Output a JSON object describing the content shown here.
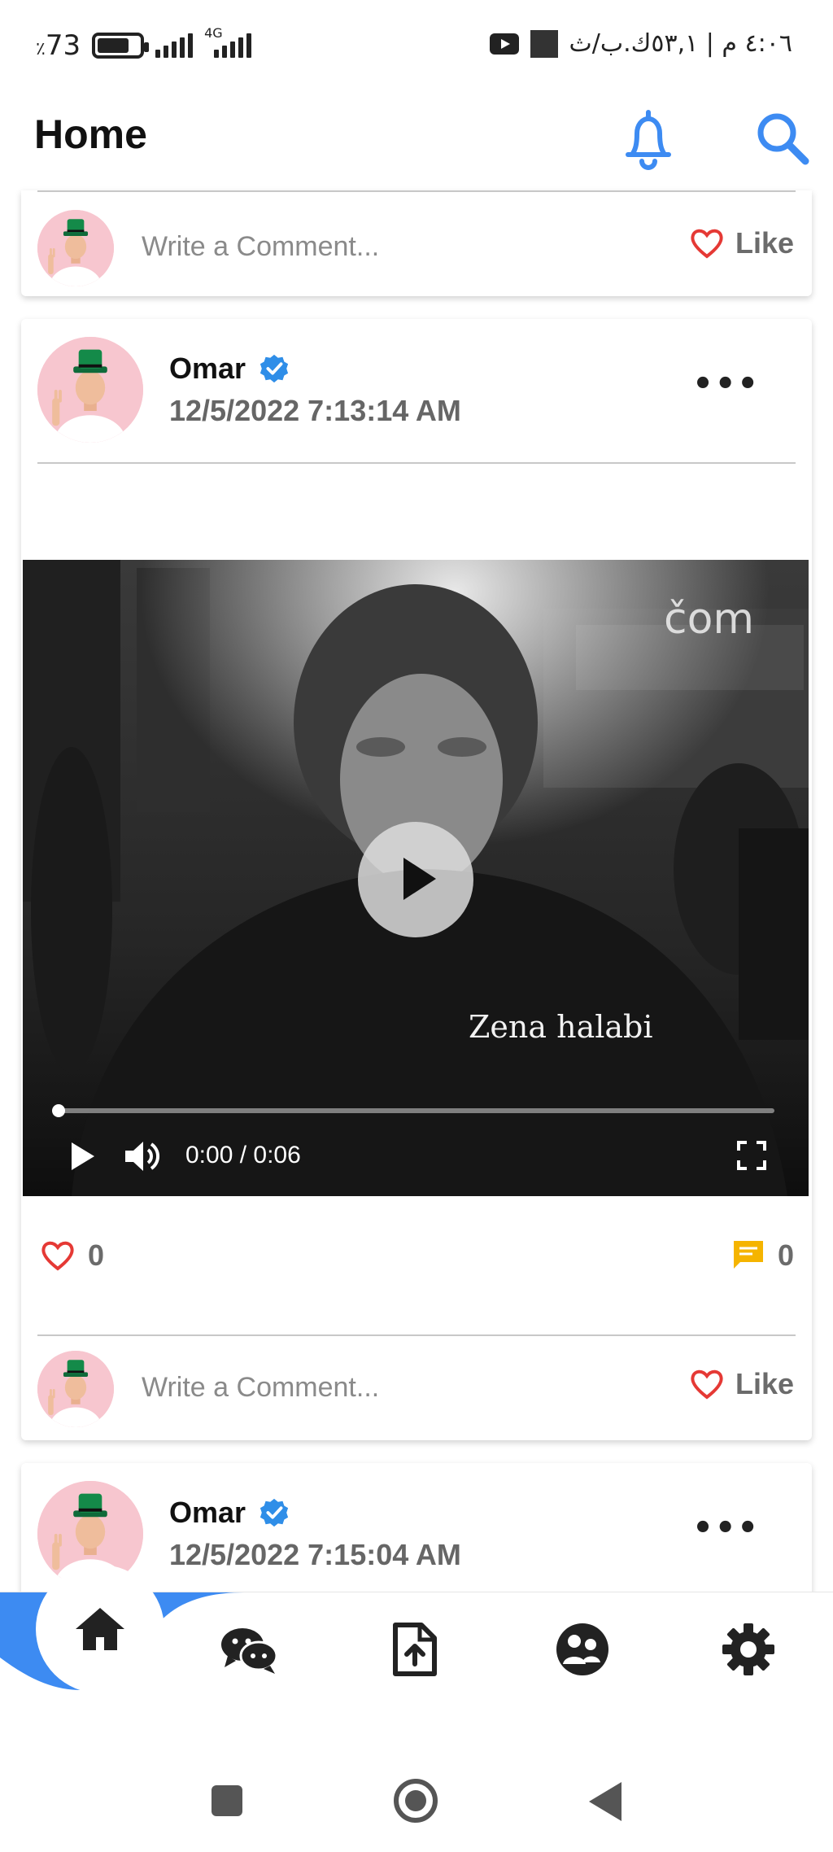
{
  "status_bar": {
    "battery_text": "73",
    "battery_level": 0.73,
    "network": "4G",
    "clock_text": "٤:٠٦ م | ٥٣,١ك.ب/ث"
  },
  "header": {
    "title": "Home",
    "icons": [
      "bell-icon",
      "search-icon"
    ]
  },
  "top_card": {
    "comment_placeholder": "Write a Comment...",
    "like_label": "Like"
  },
  "post1": {
    "author": "Omar",
    "verified": true,
    "timestamp": "12/5/2022 7:13:14 AM",
    "video": {
      "overlay_caption": "Zena halabi",
      "time_display": "0:00 / 0:06",
      "progress": 0
    },
    "likes_count": "0",
    "comments_count": "0",
    "comment_placeholder": "Write a Comment...",
    "like_label": "Like"
  },
  "post2": {
    "author": "Omar",
    "verified": true,
    "timestamp": "12/5/2022 7:15:04 AM"
  },
  "bottom_nav": {
    "items": [
      "home-icon",
      "chat-icon",
      "upload-file-icon",
      "group-icon",
      "settings-icon"
    ],
    "active": "home-icon"
  },
  "colors": {
    "accent": "#3d8bf2",
    "heart": "#e53935",
    "comment": "#f5b400",
    "verified": "#2f8ee8"
  }
}
